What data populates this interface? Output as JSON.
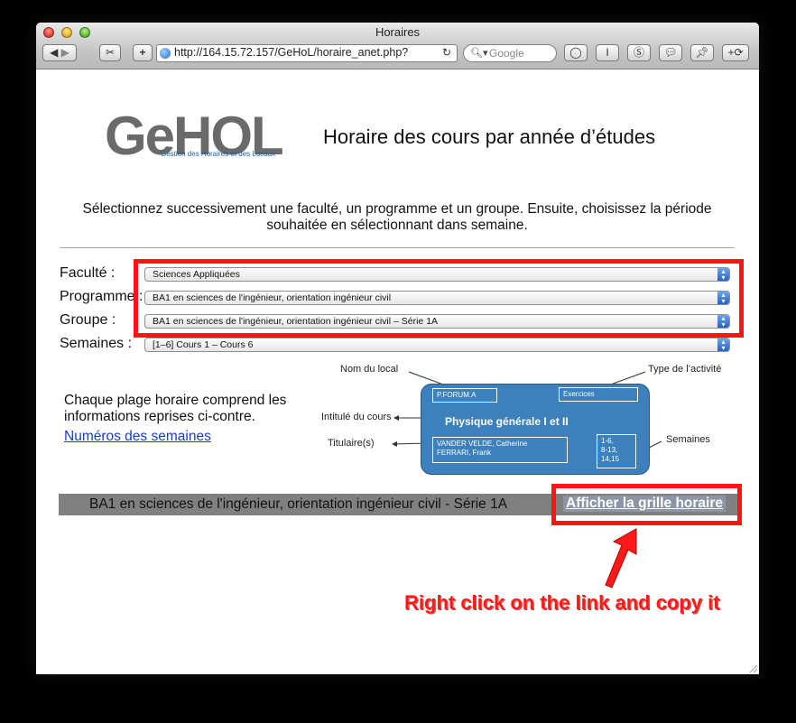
{
  "window": {
    "title": "Horaires",
    "url": "http://164.15.72.157/GeHoL/horaire_anet.php?",
    "search_placeholder": "Google",
    "toolbar_icons": [
      "back-icon",
      "forward-icon",
      "snippet-icon",
      "add-bookmark-icon",
      "reload-icon",
      "bookmarklet-o-icon",
      "bookmarklet-i-icon",
      "bookmarklet-s-icon",
      "bookmarklet-chat-icon",
      "pin-icon",
      "bookmarklet-add-icon"
    ]
  },
  "logo": {
    "text": "GeHOL",
    "subtitle": "Gestion des Horaires et des Locaux"
  },
  "page": {
    "heading": "Horaire des cours par année d’études",
    "intro": "Sélectionnez successivement une faculté, un programme et un groupe. Ensuite, choisissez la période souhaitée en sélectionnant dans semaine."
  },
  "form": {
    "faculte_label": "Faculté :",
    "faculte_value": "Sciences Appliquées",
    "programme_label": "Programme :",
    "programme_value": "BA1 en sciences de l'ingénieur, orientation ingénieur civil",
    "groupe_label": "Groupe :",
    "groupe_value": "BA1 en sciences de l'ingénieur, orientation ingénieur civil – Série 1A",
    "semaines_label": "Semaines :",
    "semaines_value": "[1–6] Cours 1 – Cours 6"
  },
  "info": {
    "line1": "Chaque plage horaire comprend les",
    "line2": "informations reprises ci-contre.",
    "weeks_link": "Numéros des semaines"
  },
  "diagram": {
    "nom_local": "Nom du local",
    "type_activite": "Type de l’activité",
    "intitule": "Intitulé du cours",
    "titulaires": "Titulaire(s)",
    "semaines": "Semaines",
    "local_value": "P.FORUM.A",
    "type_value": "Exercices",
    "course_title": "Physique générale I et II",
    "teacher1": "VANDER VELDE, Catherine",
    "teacher2": "FERRARI, Frank",
    "weeks1": "1-6,",
    "weeks2": "8-13,",
    "weeks3": "14,15"
  },
  "result_bar": {
    "group_text": "BA1 en sciences de l'ingénieur, orientation ingénieur civil - Série 1A",
    "link_text": "Afficher la grille horaire"
  },
  "annotation": {
    "text": "Right click on the link and copy it",
    "color": "#ff1a1a"
  }
}
